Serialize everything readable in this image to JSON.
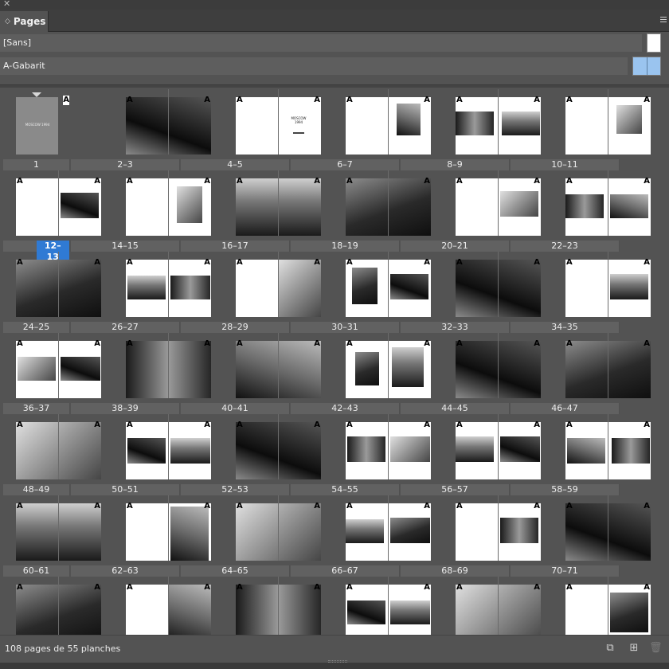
{
  "panel": {
    "close_glyph": "✕",
    "tab_arrows": "◇",
    "title": "Pages",
    "menu_icon": "panel-menu-icon"
  },
  "masters": [
    {
      "name": "[Sans]"
    },
    {
      "name": "A-Gabarit"
    }
  ],
  "master_marker": "A",
  "rows": [
    {
      "spreads": [
        {
          "label": "1",
          "single": true
        },
        {
          "label": "2–3"
        },
        {
          "label": "4–5"
        },
        {
          "label": "6–7"
        },
        {
          "label": "8–9"
        },
        {
          "label": "10–11"
        }
      ]
    },
    {
      "spreads": [
        {
          "label": "12–13",
          "selected": true
        },
        {
          "label": "14–15"
        },
        {
          "label": "16–17"
        },
        {
          "label": "18–19"
        },
        {
          "label": "20–21"
        },
        {
          "label": "22–23"
        }
      ]
    },
    {
      "spreads": [
        {
          "label": "24–25"
        },
        {
          "label": "26–27"
        },
        {
          "label": "28–29"
        },
        {
          "label": "30–31"
        },
        {
          "label": "32–33"
        },
        {
          "label": "34–35"
        }
      ]
    },
    {
      "spreads": [
        {
          "label": "36–37"
        },
        {
          "label": "38–39"
        },
        {
          "label": "40–41"
        },
        {
          "label": "42–43"
        },
        {
          "label": "44–45"
        },
        {
          "label": "46–47"
        }
      ]
    },
    {
      "spreads": [
        {
          "label": "48–49"
        },
        {
          "label": "50–51"
        },
        {
          "label": "52–53"
        },
        {
          "label": "54–55"
        },
        {
          "label": "56–57"
        },
        {
          "label": "58–59"
        }
      ]
    },
    {
      "spreads": [
        {
          "label": "60–61"
        },
        {
          "label": "62–63"
        },
        {
          "label": "64–65"
        },
        {
          "label": "66–67"
        },
        {
          "label": "68–69"
        },
        {
          "label": "70–71"
        }
      ]
    },
    {
      "spreads": [
        {
          "label": ""
        },
        {
          "label": ""
        },
        {
          "label": ""
        },
        {
          "label": ""
        },
        {
          "label": ""
        },
        {
          "label": ""
        }
      ]
    }
  ],
  "cover_text": "MOSCOW 1994",
  "title_page_text": "MOSCOW 1994",
  "footer": {
    "status": "108 pages de 55 planches",
    "buttons": [
      "edit-page-size-icon",
      "new-page-icon",
      "delete-page-icon"
    ]
  },
  "colors": {
    "panel_bg": "#535353",
    "selection": "#2f7ad4",
    "master_thumb": "#9ac4ef"
  }
}
